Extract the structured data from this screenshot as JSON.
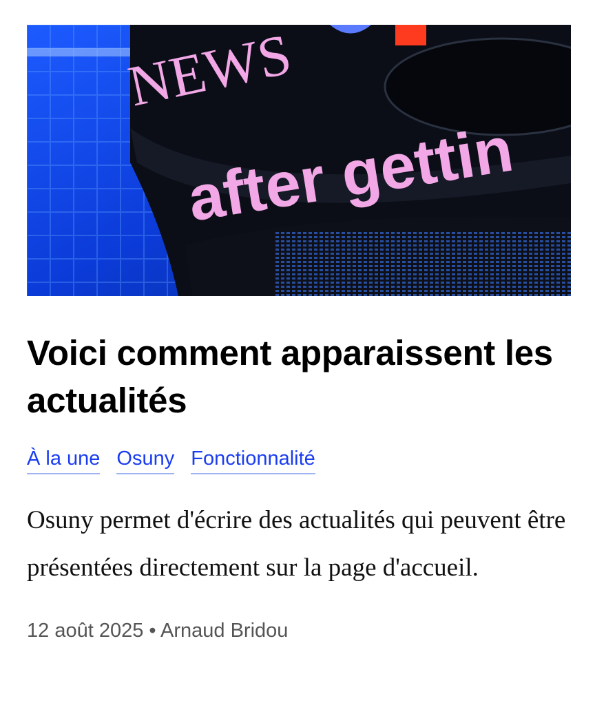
{
  "article": {
    "image": {
      "alt": "",
      "ticker_text_top": "NEWS",
      "ticker_text_main": "after gettin"
    },
    "title": "Voici comment apparaissent les actualités",
    "tags": [
      {
        "label": "À la une"
      },
      {
        "label": "Osuny"
      },
      {
        "label": "Fonctionnalité"
      }
    ],
    "summary": "Osuny permet d'écrire des actualités qui peuvent être présentées directement sur la page d'accueil.",
    "meta": {
      "date": "12 août 2025",
      "separator": "•",
      "author": "Arnaud Bridou"
    }
  },
  "colors": {
    "link": "#1a3df0",
    "title": "#000000",
    "meta": "#555555",
    "ticker_text": "#f2a7e6"
  }
}
